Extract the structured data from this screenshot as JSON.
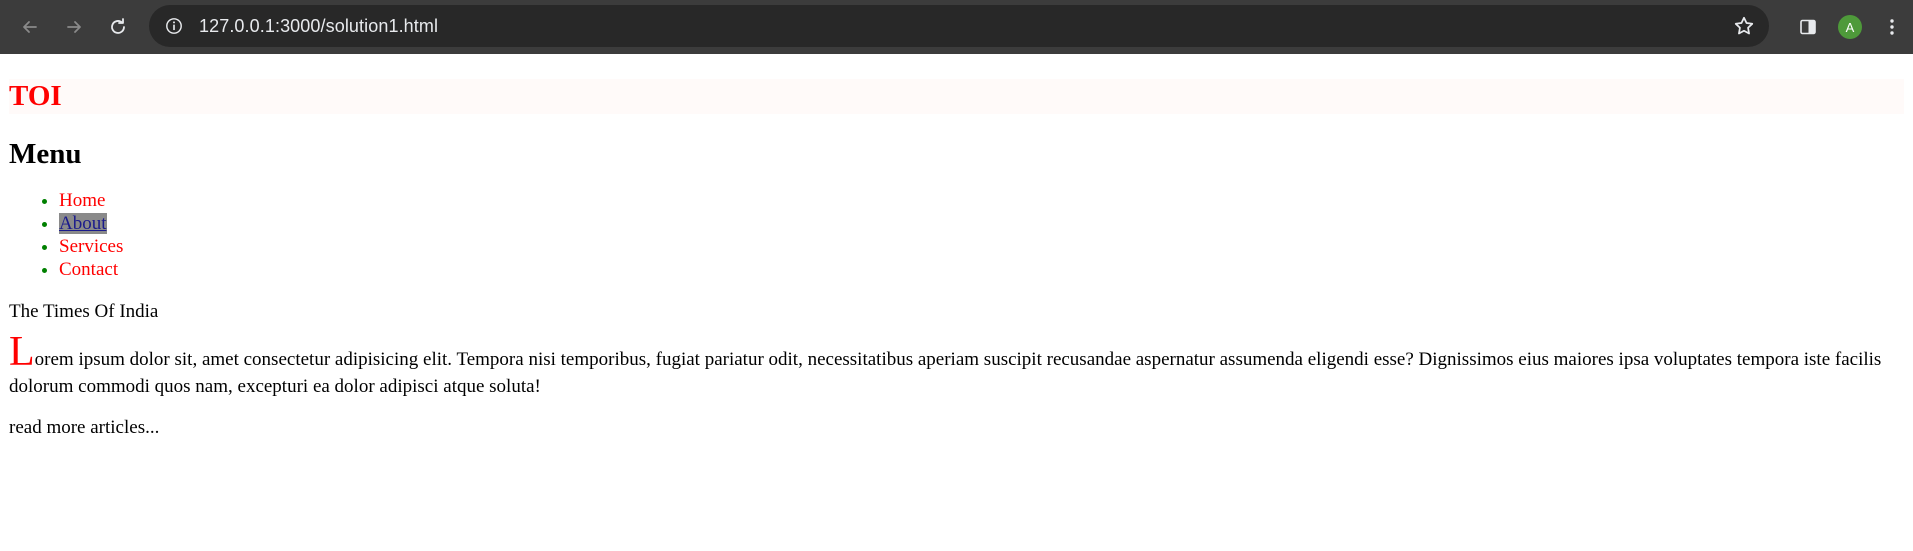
{
  "browser": {
    "url": "127.0.0.1:3000/solution1.html",
    "profile_initial": "A",
    "icons": {
      "back": "back-arrow-icon",
      "forward": "forward-arrow-icon",
      "reload": "reload-icon",
      "site_info": "info-icon",
      "bookmark": "star-icon",
      "side_panel": "side-panel-icon",
      "menu": "kebab-menu-icon"
    }
  },
  "header": {
    "brand": "TOI"
  },
  "menu": {
    "title": "Menu",
    "items": [
      {
        "label": "Home"
      },
      {
        "label": "About"
      },
      {
        "label": "Services"
      },
      {
        "label": "Contact"
      }
    ]
  },
  "content": {
    "subtitle": "The Times Of India",
    "dropcap": "L",
    "paragraph_rest": "orem ipsum dolor sit, amet consectetur adipisicing elit. Tempora nisi temporibus, fugiat pariatur odit, necessitatibus aperiam suscipit recusandae aspernatur assumenda eligendi esse? Dignissimos eius maiores ipsa voluptates tempora iste facilis dolorum commodi quos nam, excepturi ea dolor adipisci atque soluta!",
    "read_more": "read more articles..."
  },
  "colors": {
    "brand": "#ff0000",
    "bullet": "#008000",
    "link": "#ff0000",
    "active_bg": "#8a8a8a"
  }
}
